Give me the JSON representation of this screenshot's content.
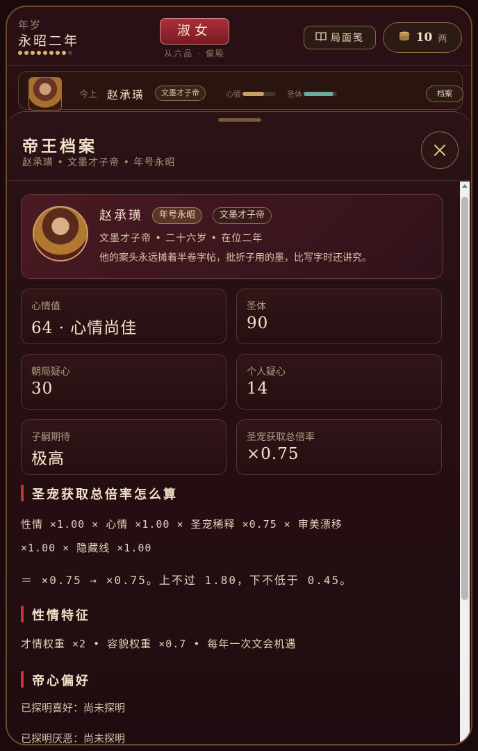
{
  "header": {
    "year_label": "年岁",
    "year_name": "永昭二年",
    "year_dots_total": 9,
    "year_dots_filled": 8,
    "rank": "淑女",
    "rank_sub": "从六品 · 偏殿",
    "journal_label": "局面笺",
    "coins": "10",
    "coin_unit": "两"
  },
  "emperor_strip": {
    "prefix": "今上",
    "name": "赵承璜",
    "tag": "文墨才子帝",
    "mood_label": "心情",
    "mood_level": 0.64,
    "health_label": "圣体",
    "health_level": 0.9,
    "archive_label": "档案"
  },
  "sheet": {
    "title": "帝王档案",
    "subtitle": "赵承璜 • 文墨才子帝 • 年号永昭",
    "profile": {
      "name": "赵承璜",
      "era_tag": "年号永昭",
      "title_tag": "文墨才子帝",
      "meta": "文墨才子帝 • 二十六岁 • 在位二年",
      "description": "他的案头永远摊着半卷字帖，批折子用的墨，比写字时还讲究。"
    },
    "stats": [
      {
        "label": "心情值",
        "value": "64 · 心情尚佳"
      },
      {
        "label": "圣体",
        "value": "90"
      },
      {
        "label": "朝局疑心",
        "value": "30"
      },
      {
        "label": "个人疑心",
        "value": "14"
      },
      {
        "label": "子嗣期待",
        "value": "极高"
      },
      {
        "label": "圣宠获取总倍率",
        "value": "×0.75"
      }
    ],
    "formula": {
      "heading": "圣宠获取总倍率怎么算",
      "line1": "性情 ×1.00  ×  心情 ×1.00  ×  圣宠稀释 ×0.75  ×  审美漂移",
      "line2": "×1.00  ×  隐藏线 ×1.00",
      "result": "＝ ×0.75 → ×0.75。上不过 1.80，下不低于 0.45。"
    },
    "traits": {
      "heading": "性情特征",
      "text": "才情权重 ×2  •  容貌权重 ×0.7  •  每年一次文会机遇"
    },
    "preferences": {
      "heading": "帝心偏好",
      "likes": "已探明喜好：尚未探明",
      "dislikes": "已探明厌恶：尚未探明"
    }
  },
  "colors": {
    "accent_gold": "#d8b56e",
    "rank_red": "#a8303a",
    "section_marker": "#c8303a",
    "mood_bar": "#c8a06e",
    "health_bar": "#6aa8a0"
  }
}
